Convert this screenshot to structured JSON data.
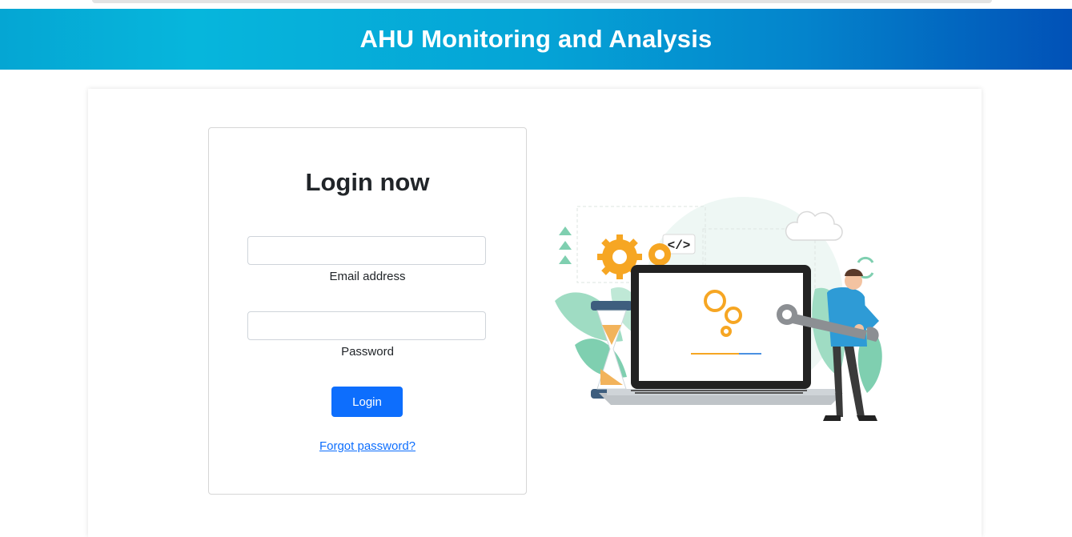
{
  "header": {
    "title": "AHU Monitoring and Analysis"
  },
  "login": {
    "title": "Login now",
    "email_label": "Email address",
    "email_value": "",
    "password_label": "Password",
    "password_value": "",
    "submit_label": "Login",
    "forgot_label": "Forgot password?"
  },
  "illustration": {
    "code_tag": "</>",
    "description_icon": "maintenance-illustration"
  },
  "colors": {
    "header_gradient_start": "#05a6d3",
    "header_gradient_end": "#0151b7",
    "primary_button": "#0d6efd",
    "link": "#0d6efd"
  }
}
